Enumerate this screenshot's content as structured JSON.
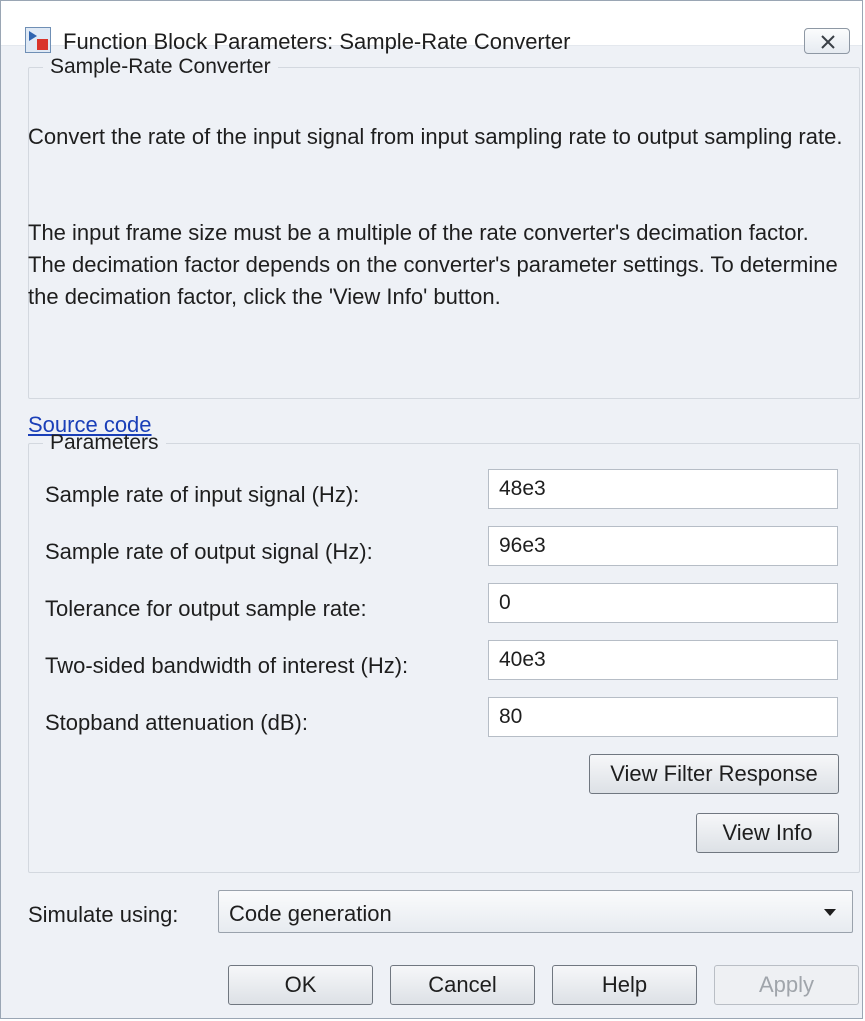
{
  "window": {
    "title": "Function Block Parameters: Sample-Rate Converter",
    "close_icon": "close-icon"
  },
  "description_group": {
    "legend": "Sample-Rate Converter",
    "paragraph1": "Convert the rate of the input signal from input sampling rate to output sampling rate.",
    "paragraph2": "The input frame size must be a multiple of the rate converter's decimation factor. The decimation factor depends on the converter's parameter settings. To determine the decimation factor, click the 'View Info' button.",
    "source_link": "Source code"
  },
  "parameters": {
    "legend": "Parameters",
    "fields": [
      {
        "label": "Sample rate of input signal (Hz):",
        "value": "48e3"
      },
      {
        "label": "Sample rate of output signal (Hz):",
        "value": "96e3"
      },
      {
        "label": "Tolerance for output sample rate:",
        "value": "0"
      },
      {
        "label": "Two-sided bandwidth of interest (Hz):",
        "value": "40e3"
      },
      {
        "label": "Stopband attenuation (dB):",
        "value": "80"
      }
    ],
    "view_filter_response_label": "View Filter Response",
    "view_info_label": "View Info"
  },
  "simulate": {
    "label": "Simulate using:",
    "selected": "Code generation"
  },
  "footer": {
    "ok_label": "OK",
    "cancel_label": "Cancel",
    "help_label": "Help",
    "apply_label": "Apply"
  },
  "colors": {
    "link": "#1a3fb8",
    "background": "#eef1f6"
  }
}
